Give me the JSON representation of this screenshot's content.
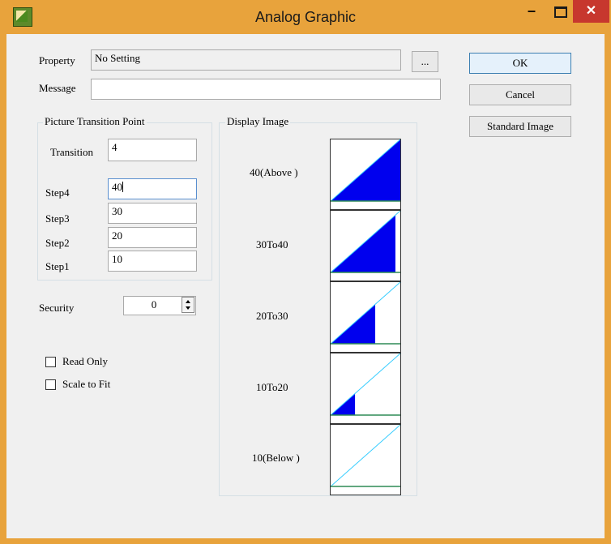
{
  "window": {
    "title": "Analog Graphic",
    "minimize_glyph": "–",
    "close_glyph": "✕"
  },
  "fields": {
    "property_label": "Property",
    "property_value": "No Setting",
    "browse_label": "...",
    "message_label": "Message",
    "message_value": ""
  },
  "buttons": {
    "ok": "OK",
    "cancel": "Cancel",
    "standard_image": "Standard Image"
  },
  "transition_group": {
    "title": "Picture Transition Point",
    "transition_label": "Transition",
    "transition_value": "4",
    "steps": [
      {
        "label": "Step4",
        "value": "40"
      },
      {
        "label": "Step3",
        "value": "30"
      },
      {
        "label": "Step2",
        "value": "20"
      },
      {
        "label": "Step1",
        "value": "10"
      }
    ]
  },
  "security": {
    "label": "Security",
    "value": "0"
  },
  "options": {
    "read_only": {
      "label": "Read Only",
      "checked": false
    },
    "scale_to_fit": {
      "label": "Scale to Fit",
      "checked": false
    }
  },
  "display_group": {
    "title": "Display Image",
    "images": [
      {
        "label": "40(Above )",
        "fill_level": 1.0
      },
      {
        "label": "30To40",
        "fill_level": 0.93
      },
      {
        "label": "20To30",
        "fill_level": 0.64
      },
      {
        "label": "10To20",
        "fill_level": 0.35
      },
      {
        "label": "10(Below )",
        "fill_level": 0.0
      }
    ]
  },
  "colors": {
    "titlebar": "#e8a33c",
    "close_button": "#c7372e",
    "fill": "#0000ee",
    "diagonal": "#33ccff",
    "baseline": "#2e8b57"
  }
}
